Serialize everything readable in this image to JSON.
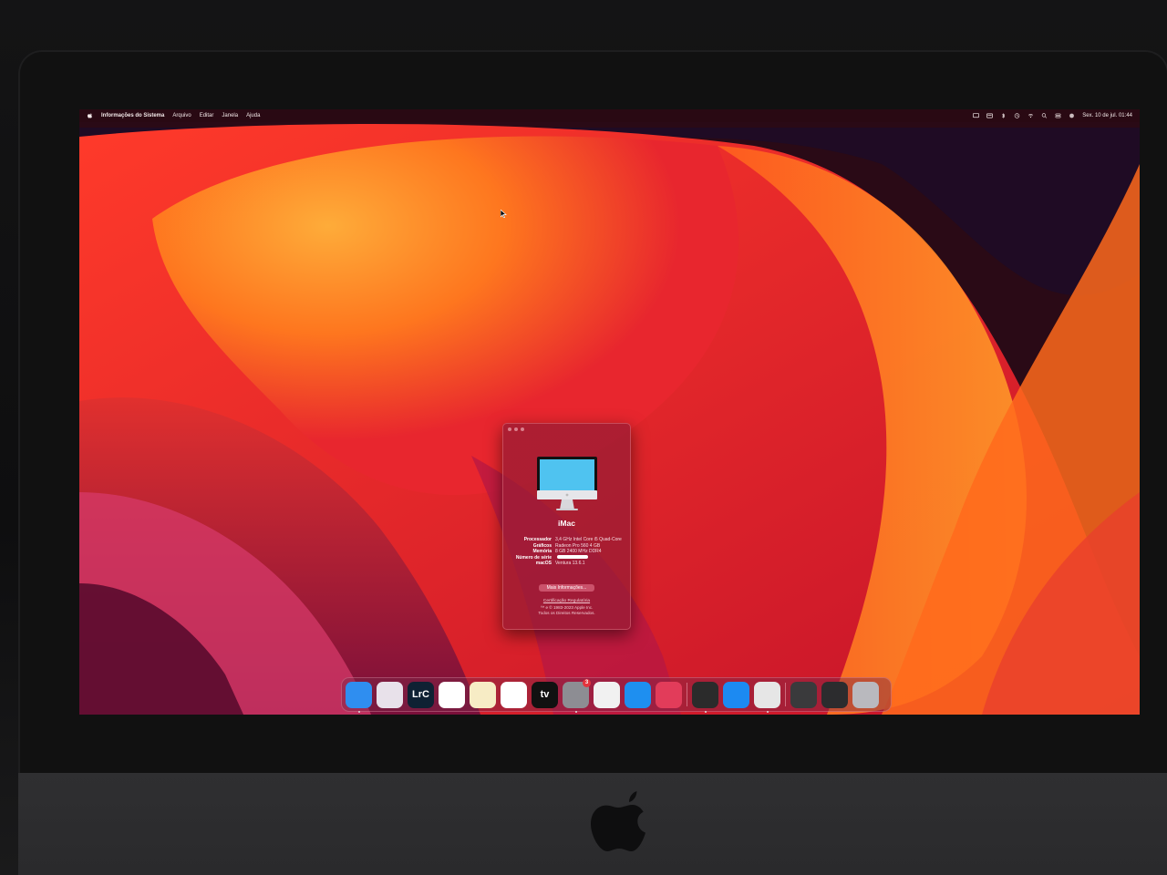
{
  "menubar": {
    "apple": "",
    "app_name": "Informações do Sistema",
    "menus": [
      "Arquivo",
      "Editar",
      "Janela",
      "Ajuda"
    ],
    "status_icons": [
      "screen-mirroring-icon",
      "keyboard-icon",
      "bluetooth-icon",
      "time-machine-icon",
      "wifi-icon",
      "spotlight-icon",
      "control-center-icon",
      "siri-icon"
    ],
    "datetime": "Sex. 10 de jul.  01:44"
  },
  "about_window": {
    "model": "iMac",
    "specs": [
      {
        "key": "Processador",
        "value": "3,4 GHz Intel Core i5 Quad-Core"
      },
      {
        "key": "Gráficos",
        "value": "Radeon Pro 560 4 GB"
      },
      {
        "key": "Memória",
        "value": "8 GB 2400 MHz DDR4"
      },
      {
        "key": "Número de série",
        "value": ""
      },
      {
        "key": "macOS",
        "value": "Ventura 13.6.1"
      }
    ],
    "more_info_button": "Mais Informações...",
    "certification_link": "Certificação Regulatória",
    "copyright_line1": "™ e © 1983-2023 Apple Inc.",
    "copyright_line2": "Todos os Direitos Reservados."
  },
  "dock": {
    "apps": [
      {
        "name": "finder",
        "label": "",
        "color": "#2f8ef0",
        "running": true
      },
      {
        "name": "launchpad",
        "label": "",
        "color": "#e8e1ea",
        "running": false
      },
      {
        "name": "lightroom-classic",
        "label": "LrC",
        "color": "#0f2133",
        "running": false
      },
      {
        "name": "chrome",
        "label": "",
        "color": "#ffffff",
        "running": false
      },
      {
        "name": "notes",
        "label": "",
        "color": "#f7ecc5",
        "running": false
      },
      {
        "name": "freeform",
        "label": "",
        "color": "#ffffff",
        "running": false
      },
      {
        "name": "apple-tv",
        "label": "tv",
        "color": "#111111",
        "running": false
      },
      {
        "name": "system-settings",
        "label": "",
        "color": "#8d8d93",
        "running": true,
        "badge": "3"
      },
      {
        "name": "preview",
        "label": "",
        "color": "#f1f1f1",
        "running": false
      },
      {
        "name": "keynote",
        "label": "",
        "color": "#1e8ff0",
        "running": false
      },
      {
        "name": "creative-cloud",
        "label": "",
        "color": "#e23c5a",
        "running": false
      },
      {
        "name": "activity-monitor",
        "label": "",
        "color": "#2b2b2b",
        "running": true
      },
      {
        "name": "app-store",
        "label": "",
        "color": "#1c8af2",
        "running": false
      },
      {
        "name": "system-information",
        "label": "",
        "color": "#e6e6e6",
        "running": true
      },
      {
        "name": "minimized-window-1",
        "label": "",
        "color": "#3a3a3c",
        "running": false
      },
      {
        "name": "minimized-window-2",
        "label": "",
        "color": "#2c2c2e",
        "running": false
      },
      {
        "name": "trash",
        "label": "",
        "color": "#b9b9be",
        "running": false
      }
    ]
  },
  "colors": {
    "wallpaper_red": "#e8232b",
    "wallpaper_orange": "#ff8a1f",
    "wallpaper_magenta": "#b0165e",
    "window_tint": "#961c34"
  }
}
